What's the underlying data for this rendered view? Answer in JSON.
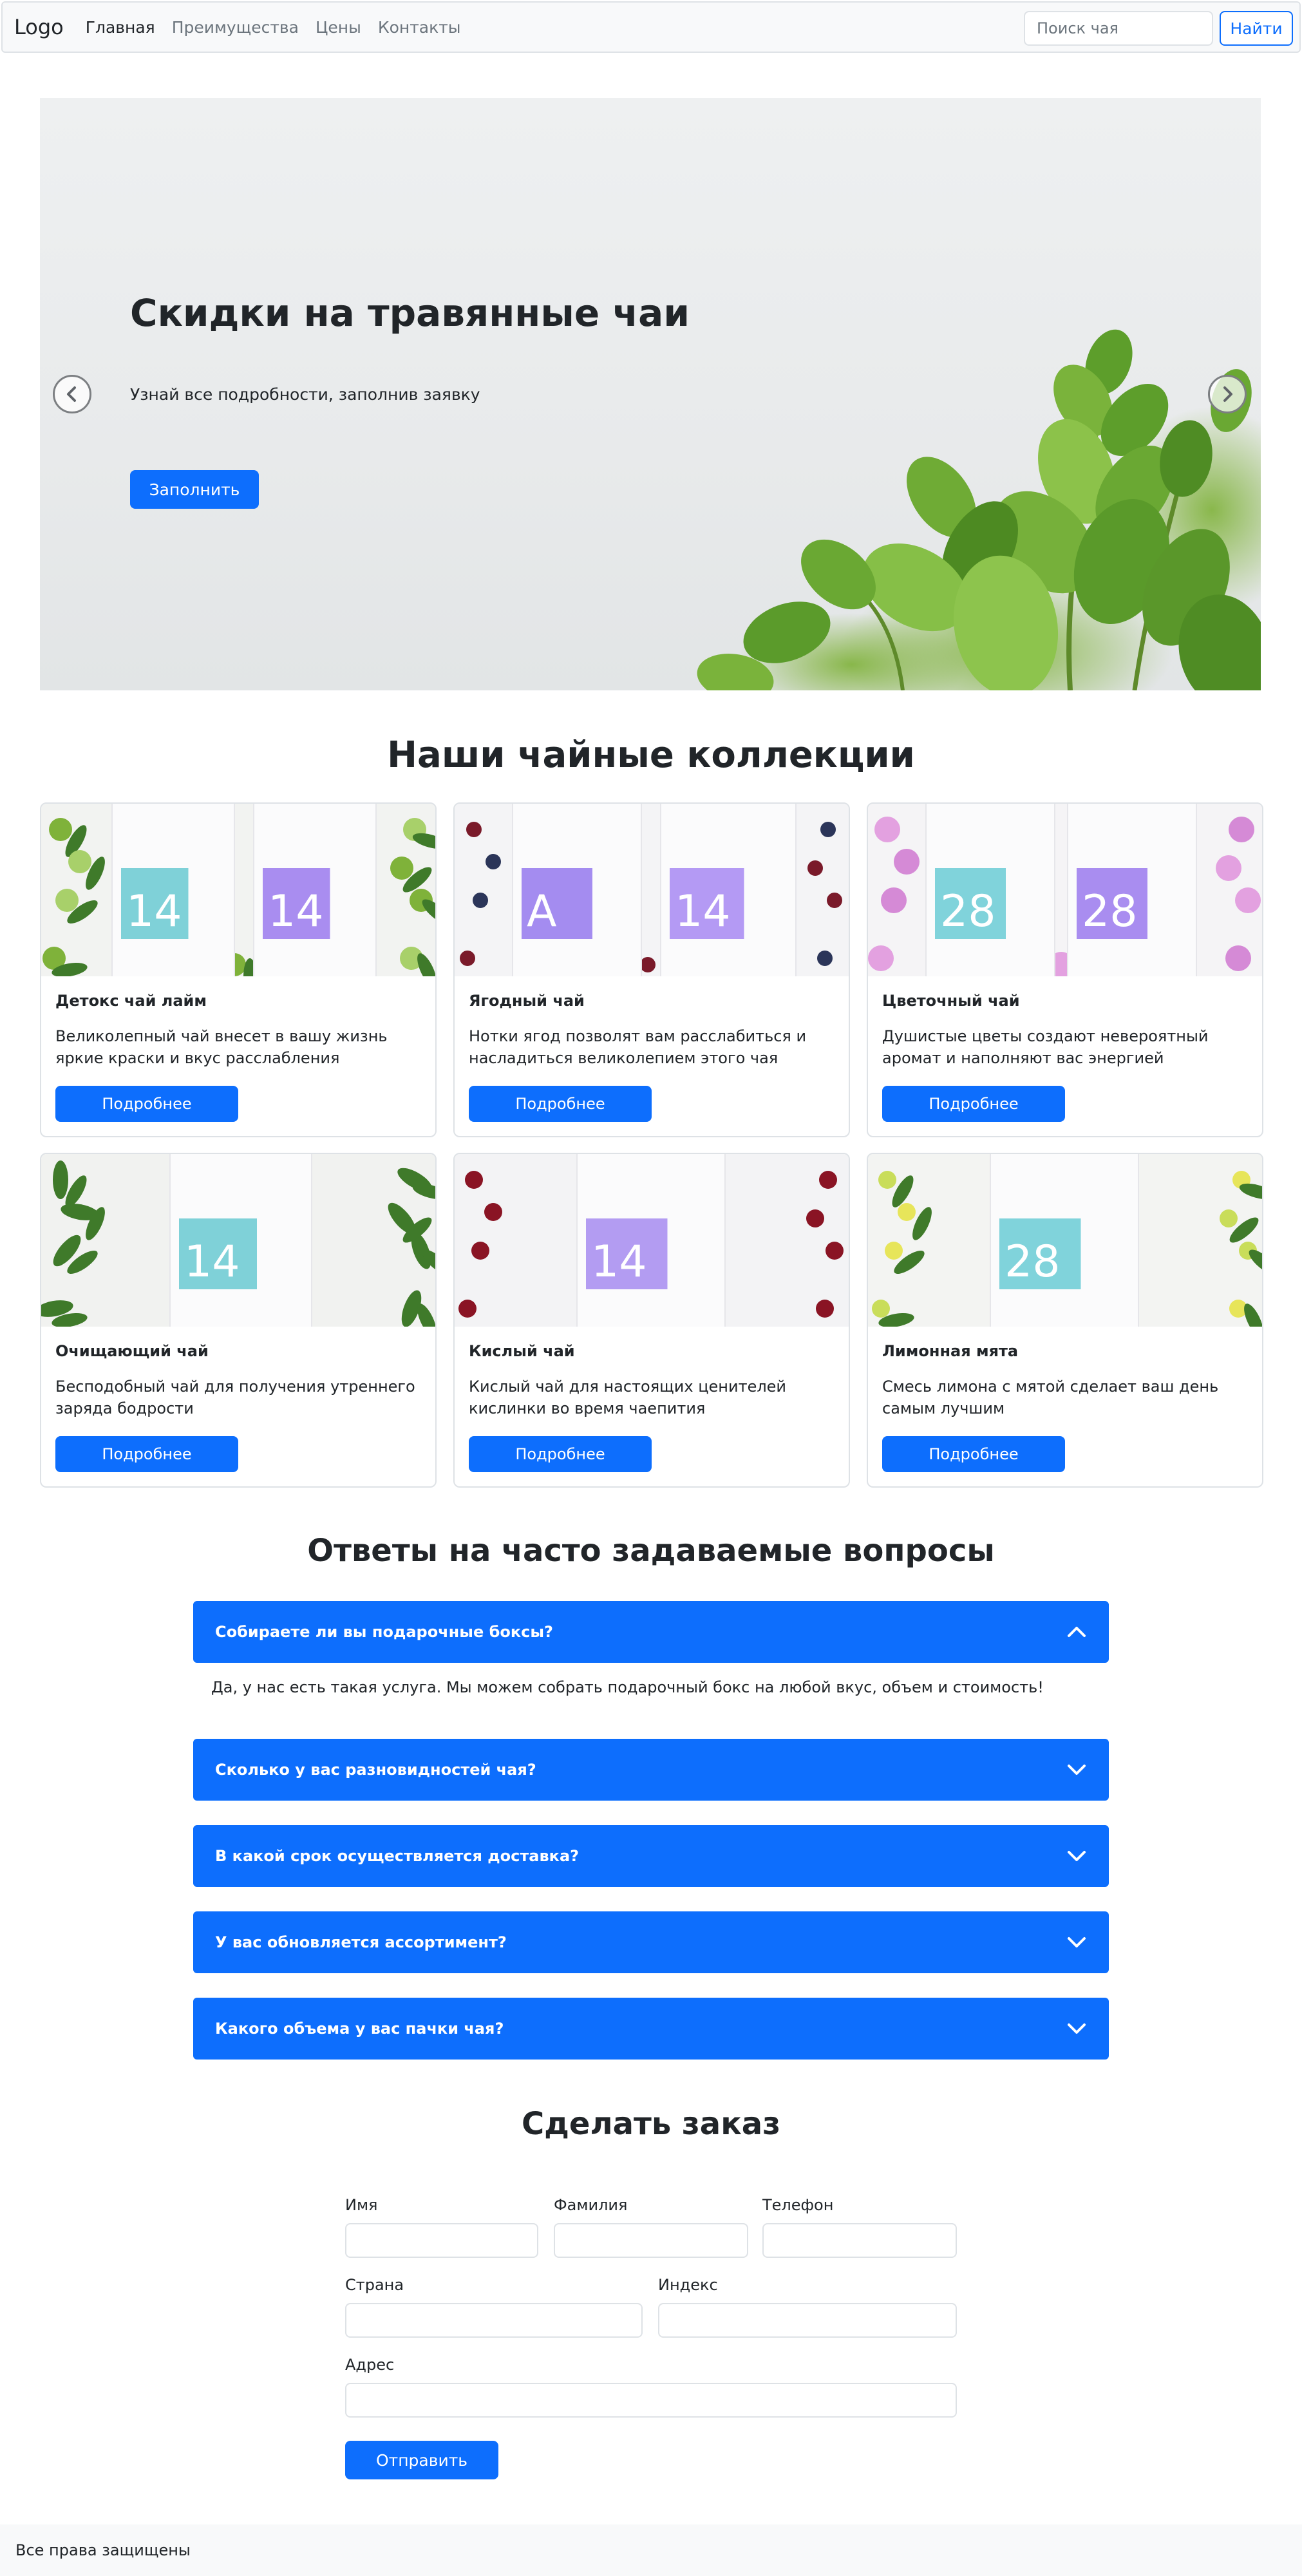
{
  "navbar": {
    "logo": "Logo",
    "links": [
      "Главная",
      "Преимущества",
      "Цены",
      "Контакты"
    ],
    "search_placeholder": "Поиск чая",
    "search_button": "Найти"
  },
  "hero": {
    "title": "Скидки на травянные чаи",
    "subtitle": "Узнай все подробности, заполнив заявку",
    "button": "Заполнить",
    "prev_icon": "chevron-left-icon",
    "next_icon": "chevron-right-icon"
  },
  "collections": {
    "title": "Наши чайные коллекции",
    "button_label": "Подробнее",
    "cards": [
      {
        "title": "Детокс чай лайм",
        "text": "Великолепный чай внесет в вашу жизнь яркие краски и вкус расслабления",
        "pack_numbers": [
          "14",
          "14"
        ]
      },
      {
        "title": "Ягодный чай",
        "text": "Нотки ягод позволят вам расслабиться и насладиться великолепием этого чая",
        "pack_numbers": [
          "A",
          "14"
        ]
      },
      {
        "title": "Цветочный чай",
        "text": "Душистые цветы создают невероятный аромат и наполняют вас энергией",
        "pack_numbers": [
          "28",
          "28"
        ]
      },
      {
        "title": "Очищающий чай",
        "text": "Бесподобный чай для получения утреннего заряда бодрости",
        "pack_numbers": [
          "14"
        ]
      },
      {
        "title": "Кислый чай",
        "text": "Кислый чай для настоящих ценителей кислинки во время чаепития",
        "pack_numbers": [
          "14"
        ]
      },
      {
        "title": "Лимонная мята",
        "text": "Смесь лимона с мятой сделает ваш день самым лучшим",
        "pack_numbers": [
          "28"
        ]
      }
    ]
  },
  "faq": {
    "title": "Ответы на часто задаваемые вопросы",
    "items": [
      {
        "question": "Собираете ли вы подарочные боксы?",
        "expanded": true
      },
      {
        "question": "Сколько у вас разновидностей чая?",
        "expanded": false
      },
      {
        "question": "В какой срок осуществляется доставка?",
        "expanded": false
      },
      {
        "question": "У вас обновляется ассортимент?",
        "expanded": false
      },
      {
        "question": "Какого объема у вас пачки чая?",
        "expanded": false
      }
    ],
    "answer": "Да, у нас есть такая услуга. Мы можем собрать подарочный бокс на любой вкус, объем и стоимость!"
  },
  "order": {
    "title": "Сделать заказ",
    "labels": {
      "first_name": "Имя",
      "last_name": "Фамилия",
      "phone": "Телефон",
      "country": "Страна",
      "zip": "Индекс",
      "address": "Адрес"
    },
    "submit": "Отправить"
  },
  "footer": {
    "text": "Все права защищены"
  },
  "colors": {
    "primary": "#0d6efd",
    "navbar_bg": "#f8f9fa",
    "text": "#212529",
    "muted": "#6c757d",
    "border": "#dee2e6"
  }
}
